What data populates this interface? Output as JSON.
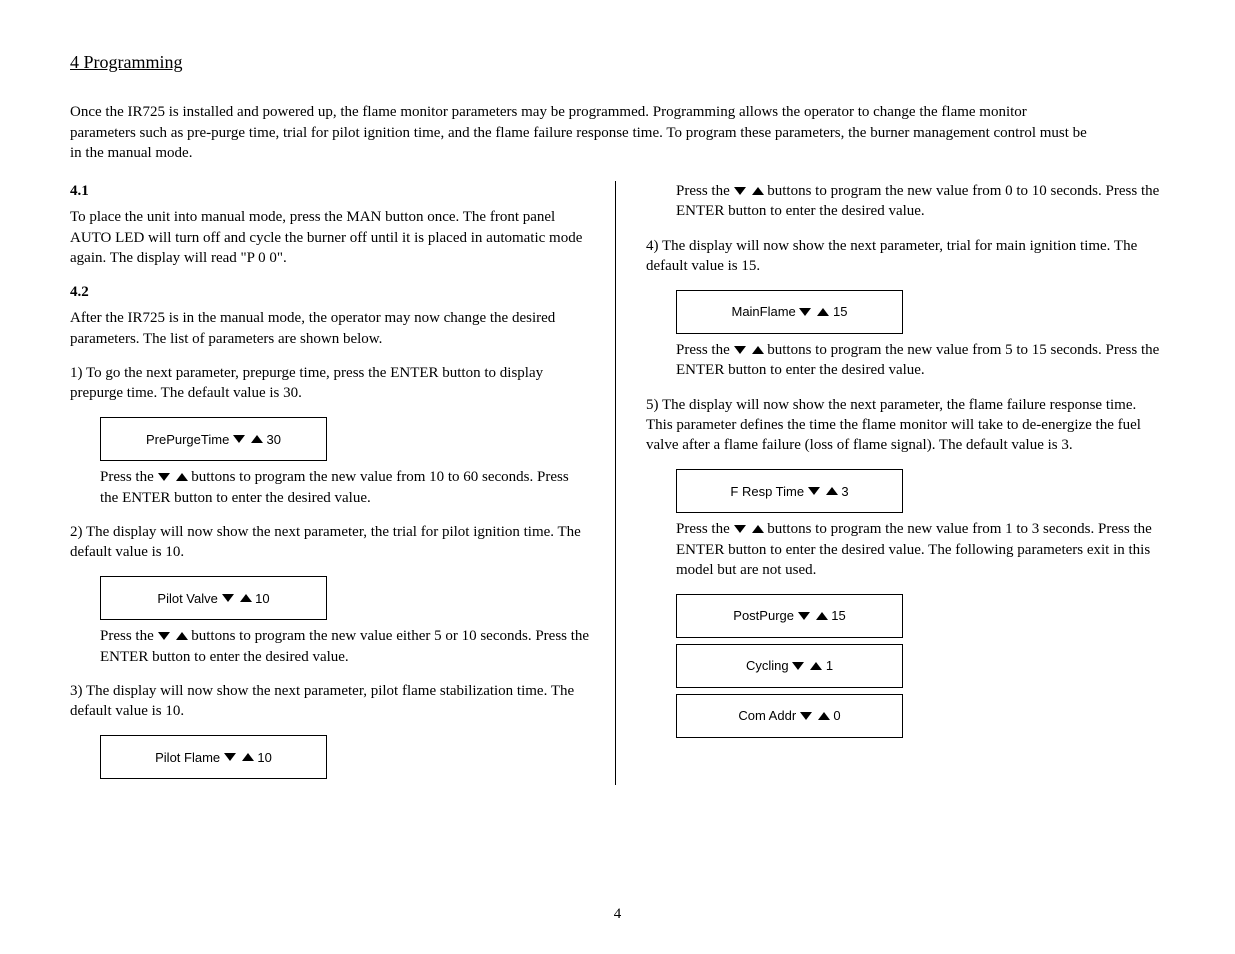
{
  "title": "4 Programming",
  "intro": "Once the IR725 is installed and powered up, the flame monitor parameters may be programmed. Programming allows the operator to change the flame monitor parameters such as pre-purge time, trial for pilot ignition time, and the flame failure response time. To program these parameters, the burner management control must be in the manual mode.",
  "left": {
    "s41": {
      "header": "4.1",
      "text": "To place the unit into manual mode, press the MAN button once. The front panel AUTO LED will turn off and cycle the burner off until it is placed in automatic mode again. The display will read \"P 0 0\"."
    },
    "s42": {
      "header": "4.2",
      "text": "After the IR725 is in the manual mode, the operator may now change the desired parameters. The list of parameters are shown below.",
      "step1": {
        "lead": "1) To go the next parameter, prepurge time, press the ENTER button to display prepurge time. The default value is 30.",
        "display_prefix": "PrePurgeTime",
        "display_suffix": "30",
        "tail_a": "Press the ",
        "tail_b": " buttons to program the new value from 10 to 60 seconds. Press the ENTER button to enter the desired value."
      },
      "step2": {
        "lead": "2) The display will now show the next parameter, the trial for pilot ignition time. The default value is 10.",
        "display_prefix": "Pilot Valve",
        "display_suffix": "10",
        "tail_a": "Press the ",
        "tail_b": " buttons to program the new value either 5 or 10 seconds. Press the ENTER button to enter the desired value."
      },
      "step3": {
        "lead": "3) The display will now show the next parameter, pilot flame stabilization time. The default value is 10.",
        "display_prefix": "Pilot Flame",
        "display_suffix": "10"
      }
    }
  },
  "right": {
    "top": {
      "tail_a": "Press the ",
      "tail_b": " buttons to program the new value from 0 to 10 seconds. Press the ENTER button to enter the desired value."
    },
    "step4": {
      "lead": "4) The display will now show the next parameter, trial for main ignition time. The default value is 15.",
      "display_prefix": "MainFlame",
      "display_suffix": "15",
      "tail_a": "Press the ",
      "tail_b": " buttons to program the new value from 5 to 15 seconds. Press the ENTER button to enter the desired value."
    },
    "step5": {
      "lead": "5) The display will now show the next parameter, the flame failure response time. This parameter defines the time the flame monitor will take to de-energize the fuel valve after a flame failure (loss of flame signal). The default value is 3.",
      "display_prefix": "F Resp Time",
      "display_suffix": "3",
      "tail_a": "Press the ",
      "tail_b": " buttons to program the new value from 1 to 3 seconds. Press the ENTER button to enter the desired value. The following parameters exit in this model but are not used."
    },
    "d_post": {
      "display_prefix": "PostPurge",
      "display_suffix": "15"
    },
    "d_cycling": {
      "display_prefix": "Cycling",
      "display_suffix": "1"
    },
    "d_comaddr": {
      "display_prefix": "Com Addr",
      "display_suffix": "0"
    }
  },
  "page_number": "4"
}
